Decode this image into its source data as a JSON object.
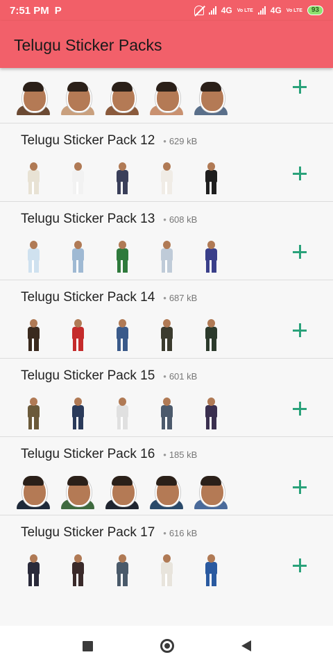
{
  "status_bar": {
    "time": "7:51 PM",
    "app_icon": "P",
    "net1": "4G",
    "net2": "4G",
    "volte": "Vo LTE",
    "battery": "93",
    "icons": [
      "notifications-off-icon",
      "signal-icon",
      "battery-icon"
    ]
  },
  "app_bar": {
    "title": "Telugu Sticker Packs"
  },
  "packs": [
    {
      "name": "",
      "size": "",
      "sticker_style": "face",
      "stickers": [
        "#6b4a33",
        "#c9a07e",
        "#8a5a3c",
        "#c99170",
        "#5a6f8a"
      ]
    },
    {
      "name": "Telugu Sticker Pack 12",
      "size": "629 kB",
      "sticker_style": "body",
      "stickers": [
        "#e8e2d4",
        "#f2f2f2",
        "#3a3f5a",
        "#f0ece6",
        "#1e1e1e"
      ]
    },
    {
      "name": "Telugu Sticker Pack 13",
      "size": "608 kB",
      "sticker_style": "body",
      "stickers": [
        "#cfe1ef",
        "#9fb9d3",
        "#2f7a3c",
        "#bfcbd8",
        "#3a3f8a"
      ]
    },
    {
      "name": "Telugu Sticker Pack 14",
      "size": "687 kB",
      "sticker_style": "body",
      "stickers": [
        "#3a2a1e",
        "#c52b2b",
        "#3a5a8a",
        "#3b3b2e",
        "#2c3a2c"
      ]
    },
    {
      "name": "Telugu Sticker Pack 15",
      "size": "601 kB",
      "sticker_style": "body",
      "stickers": [
        "#6b5a3a",
        "#2a3a5a",
        "#e0e0e0",
        "#4c5a6c",
        "#3a2f4f"
      ]
    },
    {
      "name": "Telugu Sticker Pack 16",
      "size": "185 kB",
      "sticker_style": "face",
      "stickers": [
        "#1f2a3a",
        "#3f6a3f",
        "#202530",
        "#2a4a6a",
        "#4a6a9a"
      ]
    },
    {
      "name": "Telugu Sticker Pack 17",
      "size": "616 kB",
      "sticker_style": "body",
      "stickers": [
        "#2a2a3a",
        "#3a2a2a",
        "#4a5a6a",
        "#e8e4dc",
        "#2a5aa0"
      ]
    }
  ],
  "add_icon": "plus-icon",
  "nav_bar": {
    "recents": "square-icon",
    "home": "circle-icon",
    "back": "triangle-back-icon"
  },
  "colors": {
    "app_bar": "#f2606a",
    "add_button": "#2aa27a",
    "background": "#f7f7f7"
  }
}
